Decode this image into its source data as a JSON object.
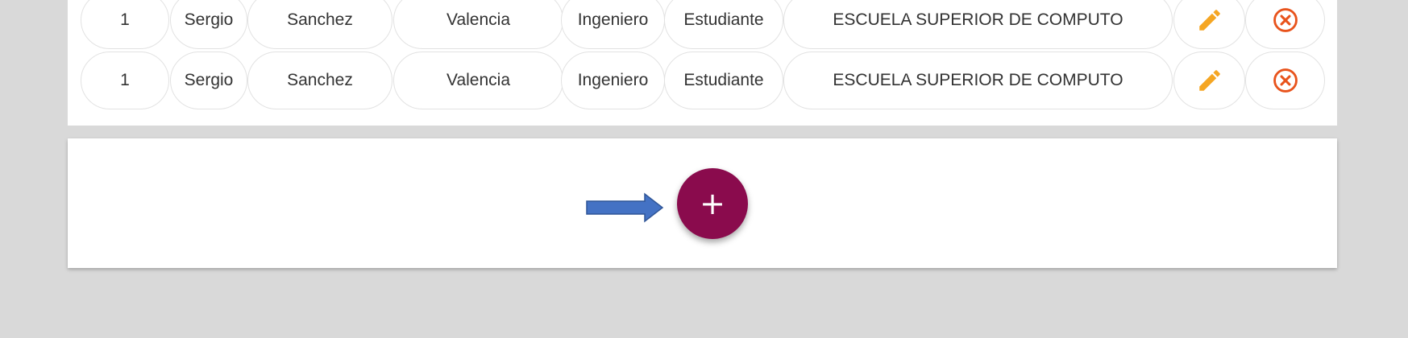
{
  "table": {
    "rows": [
      {
        "id": "1",
        "name": "Sergio",
        "last_name_1": "Sanchez",
        "last_name_2": "Valencia",
        "title": "Ingeniero",
        "role": "Estudiante",
        "school": "ESCUELA SUPERIOR DE COMPUTO",
        "edit_icon": "pencil-icon",
        "delete_icon": "close-circle-icon"
      },
      {
        "id": "1",
        "name": "Sergio",
        "last_name_1": "Sanchez",
        "last_name_2": "Valencia",
        "title": "Ingeniero",
        "role": "Estudiante",
        "school": "ESCUELA SUPERIOR DE COMPUTO",
        "edit_icon": "pencil-icon",
        "delete_icon": "close-circle-icon"
      }
    ]
  },
  "actions": {
    "add_label": "+",
    "arrow_icon": "right-arrow-icon"
  },
  "colors": {
    "background": "#d9d9d9",
    "edit": "#f5a623",
    "delete": "#e8531c",
    "fab": "#8a0b4d",
    "arrow": "#4472c4"
  }
}
